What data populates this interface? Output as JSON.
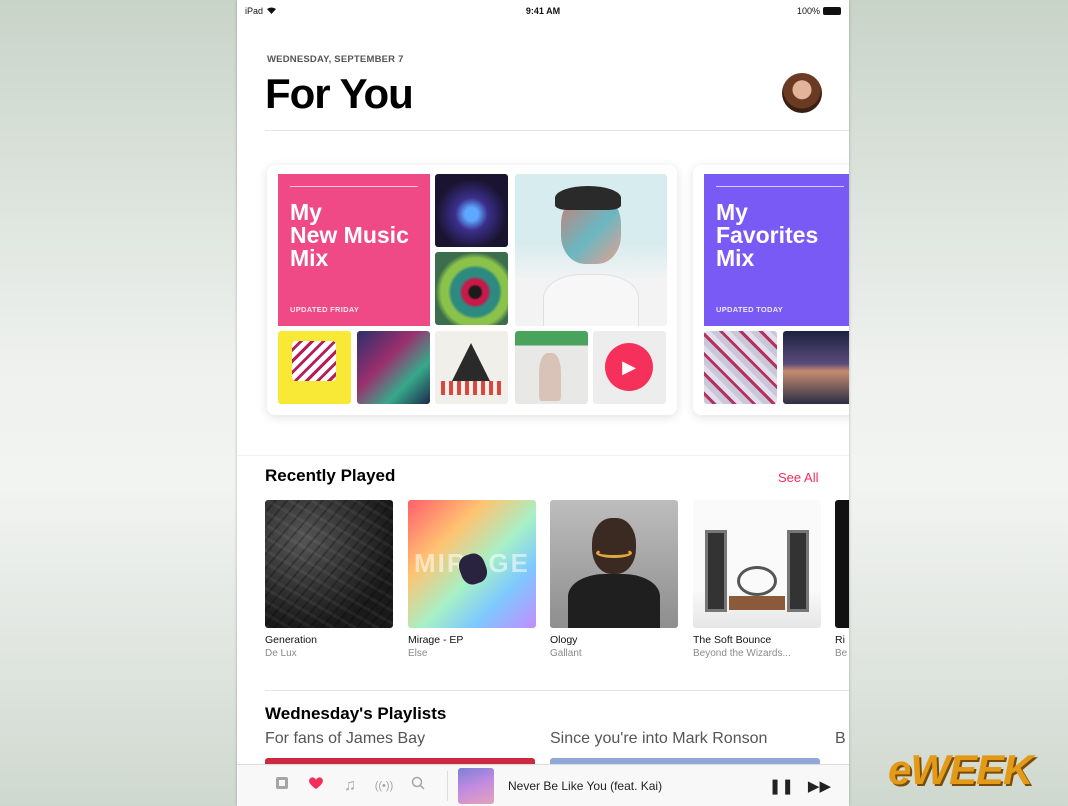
{
  "status": {
    "device": "iPad",
    "time": "9:41 AM",
    "battery": "100%"
  },
  "header": {
    "date": "WEDNESDAY, SEPTEMBER 7",
    "title": "For You"
  },
  "mixes": [
    {
      "name_lines": [
        "My",
        "New Music",
        "Mix"
      ],
      "updated": "UPDATED FRIDAY",
      "color": "#ef4a86"
    },
    {
      "name_lines": [
        "My",
        "Favorites",
        "Mix"
      ],
      "updated": "UPDATED TODAY",
      "color": "#7a5af5"
    }
  ],
  "recently_played": {
    "title": "Recently Played",
    "see_all": "See All",
    "albums": [
      {
        "title": "Generation",
        "artist": "De Lux"
      },
      {
        "title": "Mirage - EP",
        "artist": "Else"
      },
      {
        "title": "Ology",
        "artist": "Gallant"
      },
      {
        "title": "The Soft Bounce",
        "artist": "Beyond the Wizards..."
      },
      {
        "title": "Ri",
        "artist": "Be"
      }
    ],
    "mirage_art_text": "MIRAGE"
  },
  "playlists": {
    "title": "Wednesday's Playlists",
    "subtitles": [
      "For fans of James Bay",
      "Since you're into Mark Ronson",
      "B"
    ]
  },
  "now_playing": {
    "title": "Never Be Like You (feat. Kai)"
  },
  "tabs": [
    "library-icon",
    "heart-icon",
    "music-note-icon",
    "radio-icon",
    "search-icon"
  ],
  "watermark": "eWEEK",
  "accent": "#f72c5b"
}
